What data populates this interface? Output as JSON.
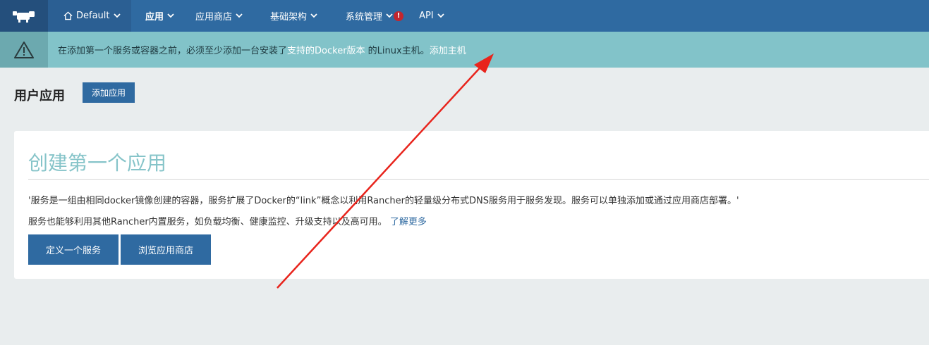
{
  "nav": {
    "env_label": "Default",
    "items": [
      {
        "label": "应用",
        "active": true
      },
      {
        "label": "应用商店",
        "active": false
      },
      {
        "label": "基础架构",
        "active": false
      },
      {
        "label": "系统管理",
        "active": false,
        "alert": "!"
      },
      {
        "label": "API",
        "active": false
      }
    ]
  },
  "banner": {
    "text_before": "在添加第一个服务或容器之前，必须至少添加一台安装了",
    "link_docker": "支持的Docker版本",
    "text_middle": " 的Linux主机。",
    "link_add_host": "添加主机"
  },
  "page": {
    "title": "用户应用",
    "add_app_label": "添加应用"
  },
  "card": {
    "title": "创建第一个应用",
    "paragraph1": "'服务是一组由相同docker镜像创建的容器，服务扩展了Docker的“link”概念以利用Rancher的轻量级分布式DNS服务用于服务发现。服务可以单独添加或通过应用商店部署。'",
    "paragraph2_text": "服务也能够利用其他Rancher内置服务，如负载均衡、健康监控、升级支持以及高可用。 ",
    "paragraph2_link": "了解更多",
    "define_service_label": "定义一个服务",
    "browse_catalog_label": "浏览应用商店"
  },
  "colors": {
    "nav_bg": "#2f6aa1",
    "banner_bg": "#82c3c9",
    "accent": "#2f6aa1",
    "title_teal": "#86c4c9",
    "annotation_red": "#e8241c"
  }
}
